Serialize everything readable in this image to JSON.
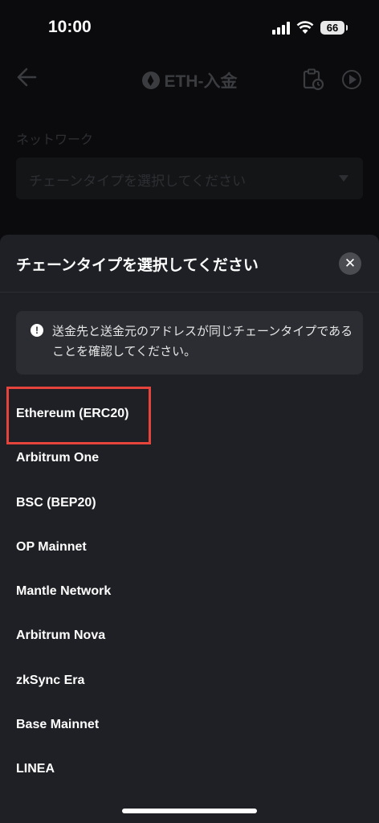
{
  "status_bar": {
    "time": "10:00",
    "battery": "66"
  },
  "header": {
    "title": "ETH-入金"
  },
  "network": {
    "label": "ネットワーク",
    "placeholder": "チェーンタイプを選択してください"
  },
  "sheet": {
    "title": "チェーンタイプを選択してください",
    "notice": "送金先と送金元のアドレスが同じチェーンタイプであることを確認してください。",
    "items": [
      "Ethereum (ERC20)",
      "Arbitrum One",
      "BSC (BEP20)",
      "OP Mainnet",
      "Mantle Network",
      "Arbitrum Nova",
      "zkSync Era",
      "Base Mainnet",
      "LINEA"
    ]
  },
  "colors": {
    "highlight": "#e5443c",
    "sheet_bg": "#1e2025"
  }
}
